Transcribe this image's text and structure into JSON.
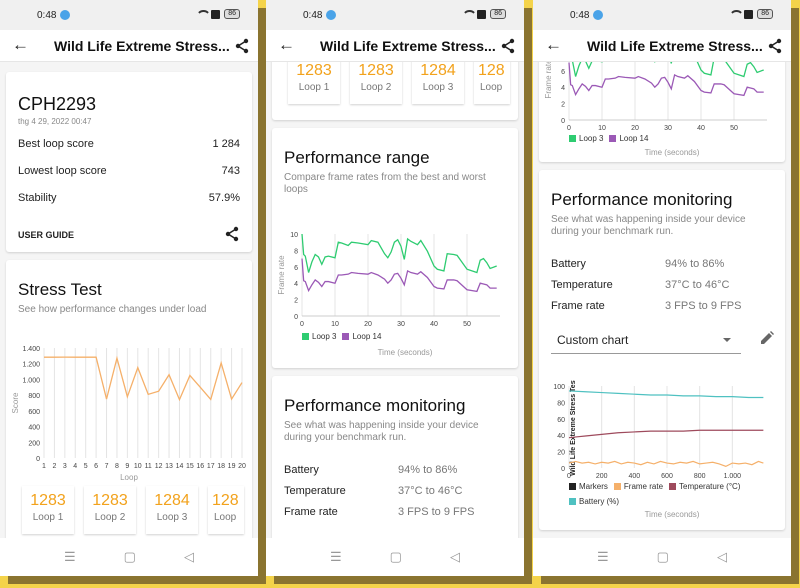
{
  "status_bar": {
    "time": "0:48",
    "battery": "86"
  },
  "app_bar": {
    "title": "Wild Life Extreme Stress..."
  },
  "nav": {
    "menu": "☰",
    "home": "▢",
    "back": "◁"
  },
  "summary": {
    "device": "CPH2293",
    "date": "thg 4 29, 2022 00:47",
    "rows": [
      {
        "label": "Best loop score",
        "value": "1 284"
      },
      {
        "label": "Lowest loop score",
        "value": "743"
      },
      {
        "label": "Stability",
        "value": "57.9%"
      }
    ],
    "user_guide": "USER GUIDE"
  },
  "stress_test": {
    "title": "Stress Test",
    "subtitle": "See how performance changes under load"
  },
  "loops": [
    {
      "score": "1283",
      "label": "Loop 1"
    },
    {
      "score": "1283",
      "label": "Loop 2"
    },
    {
      "score": "1284",
      "label": "Loop 3"
    },
    {
      "score": "128",
      "label": "Loop"
    }
  ],
  "performance_range": {
    "title": "Performance range",
    "subtitle": "Compare frame rates from the best and worst loops"
  },
  "performance_monitoring": {
    "title": "Performance monitoring",
    "subtitle": "See what was happening inside your device during your benchmark run.",
    "rows": [
      {
        "label": "Battery",
        "value": "94% to 86%"
      },
      {
        "label": "Temperature",
        "value": "37°C to 46°C"
      },
      {
        "label": "Frame rate",
        "value": "3 FPS to 9 FPS"
      }
    ],
    "select_value": "Custom chart"
  },
  "colors": {
    "accent_orange": "#f2a21c",
    "loop3": "#2ecc71",
    "loop14": "#9b59b6",
    "battery": "#4fc1c1",
    "temperature": "#9e4a5c",
    "frame_rate": "#f5b06a",
    "markers": "#222222"
  },
  "chart_data": [
    {
      "type": "line",
      "title": "Stress Test",
      "xlabel": "Loop",
      "ylabel": "Score",
      "x": [
        1,
        2,
        3,
        4,
        5,
        6,
        7,
        8,
        9,
        10,
        11,
        12,
        13,
        14,
        15,
        16,
        17,
        18,
        19,
        20
      ],
      "xticks": [
        "1",
        "2",
        "3",
        "4",
        "5",
        "6",
        "7",
        "8",
        "9",
        "10",
        "11",
        "12",
        "13",
        "14",
        "15",
        "16",
        "17",
        "18",
        "19",
        "20"
      ],
      "yticks": [
        "0",
        "200",
        "400",
        "600",
        "800",
        "1.000",
        "1.200",
        "1.400"
      ],
      "ylim": [
        0,
        1400
      ],
      "series": [
        {
          "name": "Score",
          "values": [
            1283,
            1283,
            1284,
            1283,
            1283,
            1283,
            750,
            1270,
            780,
            1150,
            810,
            850,
            1060,
            743,
            1050,
            900,
            745,
            1210,
            750,
            960
          ]
        }
      ]
    },
    {
      "type": "line",
      "title": "Performance range",
      "xlabel": "Time (seconds)",
      "ylabel": "Frame rate",
      "xlim": [
        0,
        60
      ],
      "ylim": [
        0,
        10
      ],
      "xticks": [
        "0",
        "10",
        "20",
        "30",
        "40",
        "50"
      ],
      "yticks": [
        "0",
        "2",
        "4",
        "6",
        "8",
        "10"
      ],
      "legend": [
        "Loop 3",
        "Loop 14"
      ],
      "series": [
        {
          "name": "Loop 3",
          "x": [
            0,
            0.5,
            1,
            2,
            3,
            4,
            5,
            6,
            7,
            8,
            10,
            11,
            12,
            14,
            15,
            17,
            20,
            21,
            23,
            25,
            26,
            27,
            28,
            29,
            30,
            31,
            32,
            33,
            35,
            36,
            38,
            40,
            41,
            43,
            44,
            46,
            47,
            50,
            53,
            54,
            55,
            56,
            57,
            59
          ],
          "values": [
            10,
            7.5,
            7.3,
            5.3,
            6.6,
            7.5,
            7.2,
            6.3,
            7.2,
            7.3,
            7.1,
            9.0,
            8.9,
            8.6,
            9.0,
            8.9,
            8.7,
            9.2,
            9.0,
            7.6,
            7.1,
            7.8,
            9.0,
            9.3,
            8.5,
            6.9,
            9.4,
            9.1,
            8.7,
            9.2,
            7.9,
            6.1,
            5.7,
            5.5,
            7.6,
            7.5,
            7.4,
            5.7,
            5.3,
            6.8,
            7.0,
            6.5,
            5.8,
            6.1
          ]
        },
        {
          "name": "Loop 14",
          "x": [
            0,
            0.5,
            1,
            2,
            3,
            4,
            5,
            6,
            7,
            8,
            10,
            11,
            12,
            14,
            15,
            17,
            20,
            21,
            23,
            25,
            26,
            27,
            28,
            29,
            30,
            31,
            32,
            33,
            35,
            36,
            38,
            40,
            41,
            43,
            44,
            46,
            47,
            50,
            53,
            54,
            55,
            56,
            57,
            59
          ],
          "values": [
            7,
            4.3,
            4.2,
            3.1,
            3.8,
            4.4,
            4.1,
            3.6,
            4.2,
            4.2,
            4.0,
            5.0,
            5.0,
            5.1,
            5.3,
            5.2,
            5.1,
            5.3,
            5.0,
            4.5,
            4.0,
            4.4,
            5.1,
            5.2,
            4.6,
            3.8,
            5.5,
            5.3,
            5.1,
            5.4,
            4.7,
            3.6,
            3.4,
            3.3,
            4.4,
            4.4,
            4.3,
            3.2,
            3.0,
            4.0,
            3.9,
            3.8,
            3.4,
            3.4
          ]
        }
      ]
    },
    {
      "type": "line",
      "title": "Custom chart",
      "xlabel": "Time (seconds)",
      "ylabel": "Wild Life Extreme Stress Test",
      "xlim": [
        0,
        1200
      ],
      "ylim": [
        0,
        100
      ],
      "xticks": [
        "0",
        "200",
        "400",
        "600",
        "800",
        "1.000"
      ],
      "yticks": [
        "0",
        "20",
        "40",
        "60",
        "80",
        "100"
      ],
      "legend": [
        "Markers",
        "Frame rate",
        "Temperature (°C)",
        "Battery (%)"
      ],
      "series": [
        {
          "name": "Battery (%)",
          "x": [
            0,
            100,
            200,
            300,
            400,
            500,
            600,
            700,
            800,
            900,
            1000,
            1100,
            1190
          ],
          "values": [
            94,
            93,
            92,
            91,
            90,
            89,
            89,
            88,
            88,
            87,
            87,
            86,
            86
          ]
        },
        {
          "name": "Temperature (°C)",
          "x": [
            0,
            50,
            100,
            200,
            300,
            400,
            500,
            600,
            700,
            800,
            900,
            1000,
            1100,
            1190
          ],
          "values": [
            37,
            38,
            39,
            41,
            43,
            44,
            45,
            45,
            45,
            46,
            46,
            46,
            46,
            46
          ]
        },
        {
          "name": "Frame rate",
          "x": [
            0,
            40,
            80,
            120,
            160,
            200,
            240,
            280,
            320,
            360,
            400,
            440,
            480,
            520,
            560,
            600,
            640,
            680,
            720,
            760,
            800,
            840,
            880,
            920,
            960,
            1000,
            1040,
            1080,
            1120,
            1160,
            1190
          ],
          "values": [
            6,
            8,
            6,
            7,
            5,
            7,
            6,
            8,
            5,
            7,
            6,
            4,
            7,
            5,
            8,
            6,
            5,
            7,
            6,
            8,
            5,
            6,
            7,
            5,
            2,
            6,
            5,
            6,
            4,
            8,
            6
          ]
        }
      ]
    }
  ]
}
